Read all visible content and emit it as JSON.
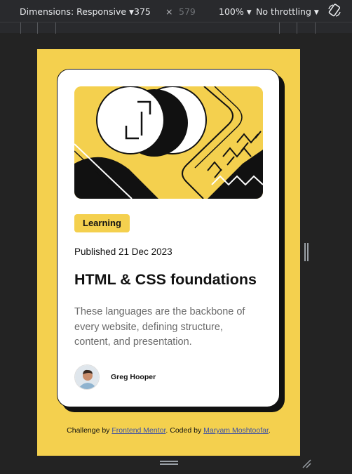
{
  "toolbar": {
    "dimensions_label": "Dimensions: Responsive",
    "width_value": "375",
    "times": "×",
    "height_value": "579",
    "zoom": "100%",
    "throttling": "No throttling"
  },
  "card": {
    "tag": "Learning",
    "published": "Published 21 Dec 2023",
    "title": "HTML & CSS foundations",
    "description": "These languages are the backbone of every website, defining structure, content, and presentation.",
    "author": "Greg Hooper"
  },
  "attribution": {
    "prefix": "Challenge by",
    "link1": "Frontend Mentor",
    "middle": ". Coded by",
    "link2": "Maryam Moshtoofar",
    "suffix": "."
  },
  "colors": {
    "accent": "#f4d04e",
    "ink": "#111111",
    "link": "#3e52a3",
    "devtools_bg": "#292a2d"
  }
}
